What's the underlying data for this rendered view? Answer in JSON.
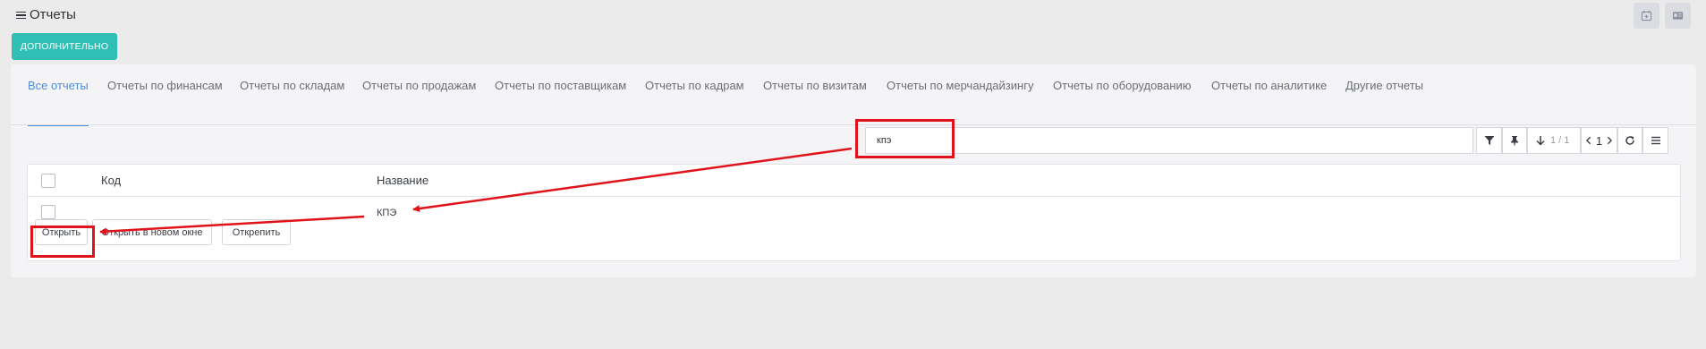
{
  "header": {
    "title": "Отчеты",
    "menu_icon": "hamburger-icon",
    "right_icons": [
      "calendar-icon",
      "id-card-icon"
    ]
  },
  "more_button": {
    "label": "ДОПОЛНИТЕЛЬНО"
  },
  "tabs": [
    {
      "label": "Все отчеты",
      "active": true
    },
    {
      "label": "Отчеты по финансам",
      "active": false
    },
    {
      "label": "Отчеты по складам",
      "active": false
    },
    {
      "label": "Отчеты по продажам",
      "active": false
    },
    {
      "label": "Отчеты по поставщикам",
      "active": false
    },
    {
      "label": "Отчеты по кадрам",
      "active": false
    },
    {
      "label": "Отчеты по визитам",
      "active": false
    },
    {
      "label": "Отчеты по мерчандайзингу",
      "active": false
    },
    {
      "label": "Отчеты по оборудованию",
      "active": false
    },
    {
      "label": "Отчеты по аналитике",
      "active": false
    },
    {
      "label": "Другие отчеты",
      "active": false
    }
  ],
  "search": {
    "value": "кпэ"
  },
  "toolbar": {
    "icons": [
      "filter-icon",
      "pin-icon",
      "sort-down-icon",
      "chevron-left-icon",
      "chevron-right-icon",
      "refresh-icon",
      "menu-icon"
    ],
    "record_count": "1 / 1",
    "page": "1"
  },
  "grid": {
    "columns": {
      "code": "Код",
      "name": "Название"
    },
    "rows": [
      {
        "code": "",
        "name": "КПЭ"
      }
    ],
    "row_actions": {
      "open": "Открыть",
      "open_new_window": "Открыть в новом окне",
      "unpin": "Открепить"
    }
  },
  "colors": {
    "accent": "#2fbfb4",
    "tab_active": "#4e8ddc",
    "annotation": "#e0121a"
  }
}
